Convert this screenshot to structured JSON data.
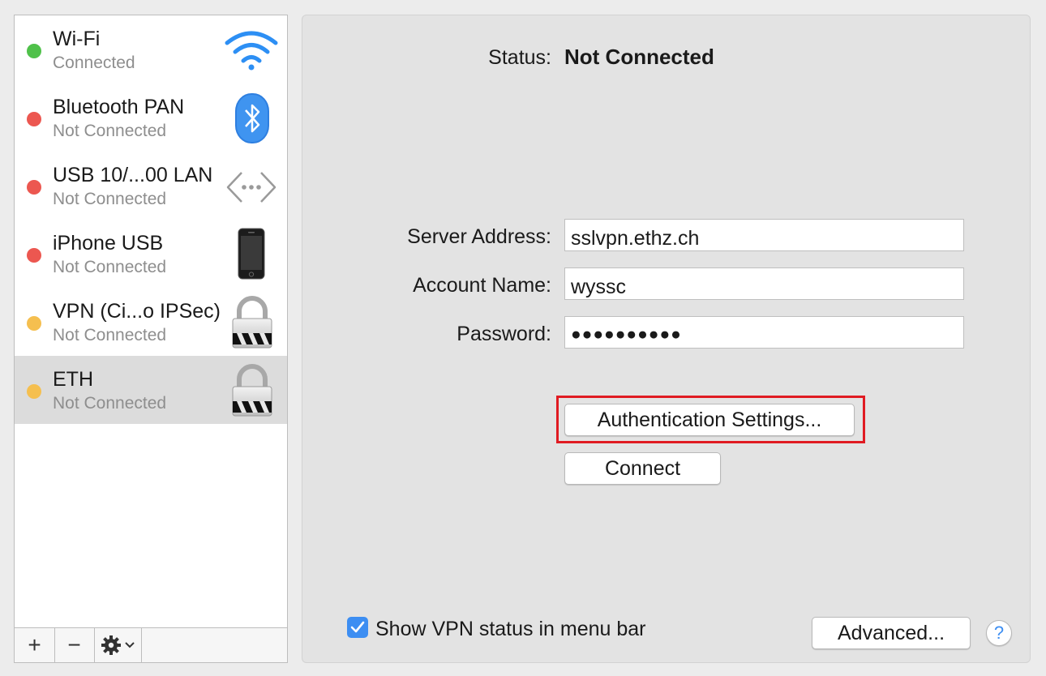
{
  "services": [
    {
      "name": "Wi-Fi",
      "status": "Connected",
      "status_color": "#4fc14a",
      "icon": "wifi-icon"
    },
    {
      "name": "Bluetooth PAN",
      "status": "Not Connected",
      "status_color": "#ec5750",
      "icon": "bluetooth-icon"
    },
    {
      "name": "USB 10/...00 LAN",
      "status": "Not Connected",
      "status_color": "#ec5750",
      "icon": "ethernet-icon"
    },
    {
      "name": "iPhone USB",
      "status": "Not Connected",
      "status_color": "#ec5750",
      "icon": "iphone-icon"
    },
    {
      "name": "VPN (Ci...o IPSec)",
      "status": "Not Connected",
      "status_color": "#f5bf4f",
      "icon": "vpn-lock-icon"
    },
    {
      "name": "ETH",
      "status": "Not Connected",
      "status_color": "#f5bf4f",
      "icon": "vpn-lock-icon",
      "selected": true
    }
  ],
  "toolbar": {
    "add": "+",
    "remove": "−",
    "action_icon": "gear-icon",
    "menu_icon": "chevron-down-icon"
  },
  "status": {
    "label": "Status:",
    "value": "Not Connected"
  },
  "form": {
    "server_label": "Server Address:",
    "server_value": "sslvpn.ethz.ch",
    "account_label": "Account Name:",
    "account_value": "wyssc",
    "password_label": "Password:",
    "password_value": "●●●●●●●●●●"
  },
  "buttons": {
    "auth_settings": "Authentication Settings...",
    "connect": "Connect",
    "advanced": "Advanced...",
    "help": "?"
  },
  "show_vpn_status": {
    "label": "Show VPN status in menu bar",
    "checked": true
  },
  "colors": {
    "accent": "#3d8ef2",
    "highlight": "#e01b22"
  }
}
